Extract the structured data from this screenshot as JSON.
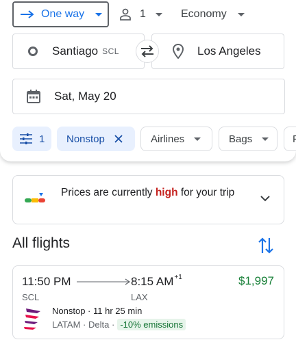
{
  "search": {
    "trip_type": "One way",
    "passengers": "1",
    "cabin": "Economy",
    "origin_city": "Santiago",
    "origin_code": "SCL",
    "destination": "Los Angeles",
    "date": "Sat, May 20"
  },
  "filters": {
    "all_filters_count": "1",
    "nonstop": "Nonstop",
    "airlines": "Airlines",
    "bags": "Bags",
    "more": "P"
  },
  "insight": {
    "before": "Prices are currently ",
    "level": "high",
    "after": " for your trip"
  },
  "results": {
    "title": "All flights"
  },
  "flight": {
    "departure_time": "11:50 PM",
    "arrival_time": "8:15 AM",
    "day_offset": "+1",
    "price": "$1,997",
    "departure_code": "SCL",
    "arrival_code": "LAX",
    "stops": "Nonstop",
    "duration": "11 hr 25 min",
    "separator": "·",
    "airline": "LATAM",
    "partner": "Delta",
    "emissions": "-10% emissions"
  },
  "colors": {
    "accent": "#1a73e8",
    "price_green": "#188038",
    "price_high_red": "#c5221f",
    "chip_active_bg": "#e8f0fe",
    "emissions_bg": "#e6f4ea"
  },
  "icons": {
    "trip_type": "arrow-right-icon",
    "passengers": "person-icon",
    "origin": "circle-icon",
    "swap": "swap-icon",
    "destination": "location-pin-icon",
    "date": "calendar-icon",
    "filters": "tune-icon",
    "remove": "close-icon",
    "insight": "price-gauge-icon",
    "expand": "chevron-down-icon",
    "sort": "sort-icon",
    "airline_logo": "latam-logo"
  }
}
